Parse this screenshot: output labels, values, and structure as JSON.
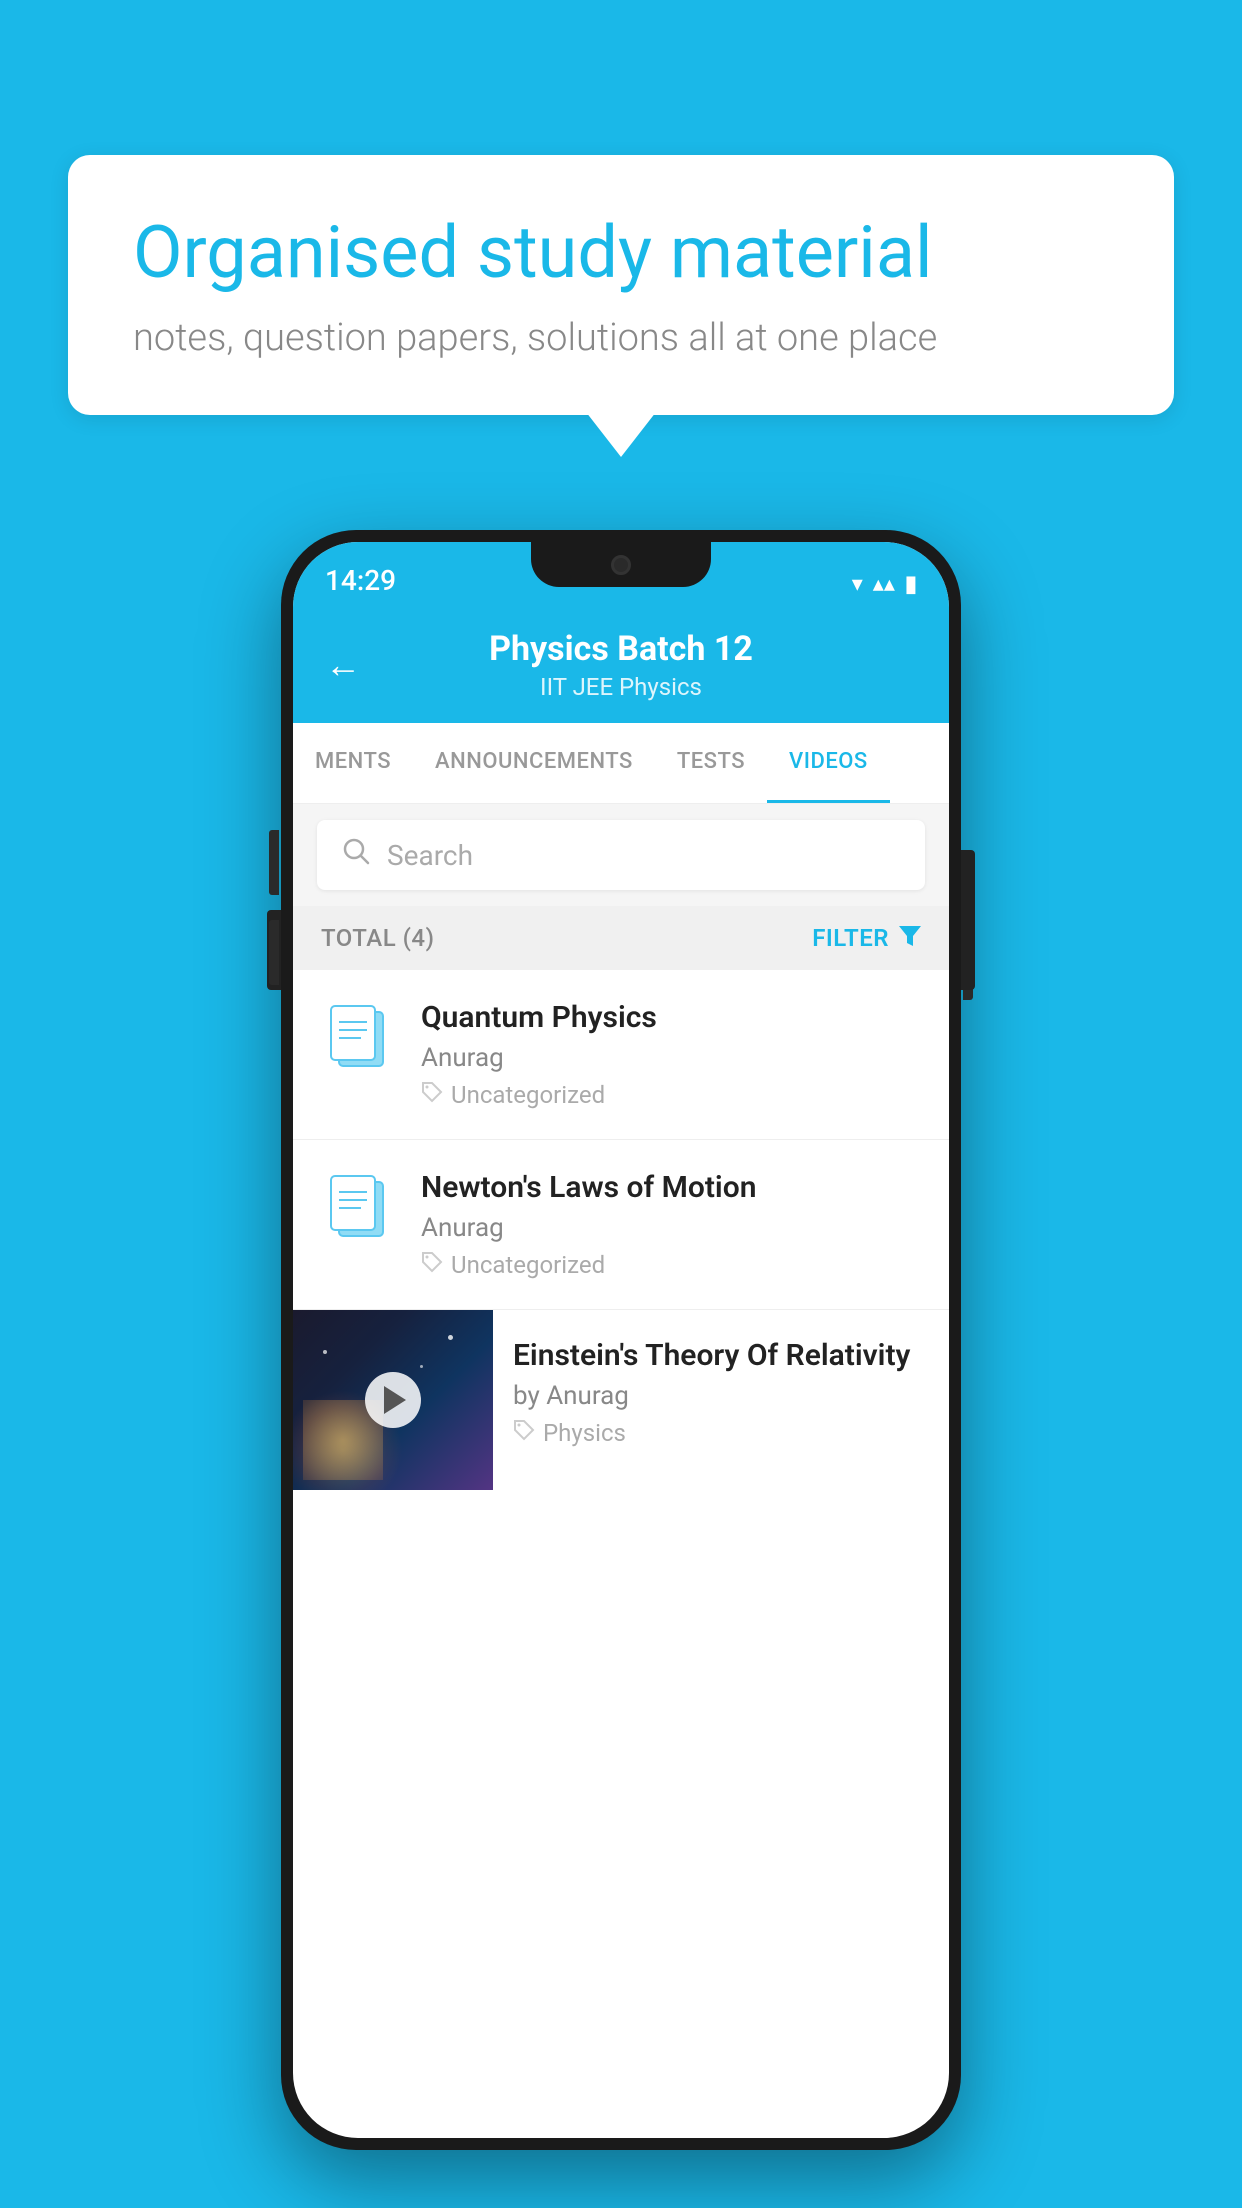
{
  "background_color": "#1ab8e8",
  "speech_bubble": {
    "title": "Organised study material",
    "subtitle": "notes, question papers, solutions all at one place"
  },
  "phone": {
    "status_bar": {
      "time": "14:29",
      "wifi": "▾",
      "signal": "▴▴",
      "battery": "▮"
    },
    "header": {
      "back_label": "←",
      "title": "Physics Batch 12",
      "subtitle": "IIT JEE   Physics"
    },
    "tabs": [
      {
        "label": "MENTS",
        "active": false
      },
      {
        "label": "ANNOUNCEMENTS",
        "active": false
      },
      {
        "label": "TESTS",
        "active": false
      },
      {
        "label": "VIDEOS",
        "active": true
      }
    ],
    "search": {
      "placeholder": "Search"
    },
    "filter_bar": {
      "total_label": "TOTAL (4)",
      "filter_label": "FILTER"
    },
    "videos": [
      {
        "id": 1,
        "title": "Quantum Physics",
        "author": "Anurag",
        "tag": "Uncategorized",
        "type": "folder"
      },
      {
        "id": 2,
        "title": "Newton's Laws of Motion",
        "author": "Anurag",
        "tag": "Uncategorized",
        "type": "folder"
      },
      {
        "id": 3,
        "title": "Einstein's Theory Of Relativity",
        "author": "by Anurag",
        "tag": "Physics",
        "type": "video"
      }
    ]
  }
}
